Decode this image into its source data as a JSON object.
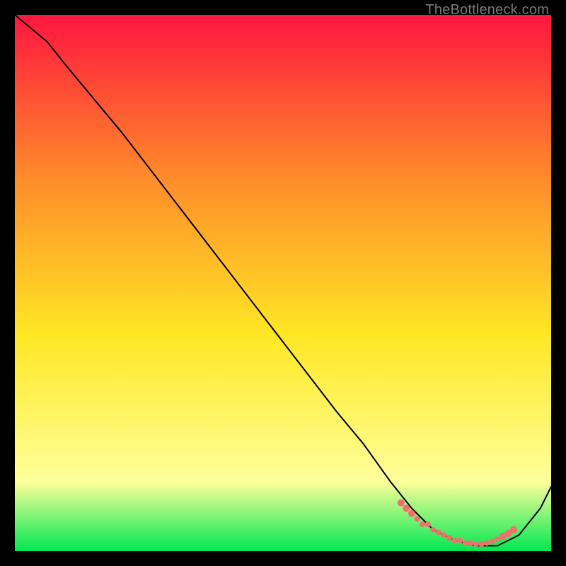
{
  "watermark": "TheBottleneck.com",
  "colors": {
    "frame": "#000000",
    "gradient_top": "#ff163f",
    "gradient_mid_upper": "#ff8a2a",
    "gradient_mid": "#ffe824",
    "gradient_low": "#ffff9a",
    "gradient_bottom": "#00e851",
    "line": "#000000",
    "marker": "#f2706b"
  },
  "chart_data": {
    "type": "line",
    "title": "",
    "xlabel": "",
    "ylabel": "",
    "xlim": [
      0,
      100
    ],
    "ylim": [
      0,
      100
    ],
    "grid": false,
    "legend": false,
    "series": [
      {
        "name": "curve",
        "x": [
          0,
          6,
          10,
          20,
          30,
          40,
          50,
          60,
          65,
          70,
          74,
          78,
          82,
          86,
          90,
          94,
          98,
          100
        ],
        "y": [
          100,
          95,
          90,
          78,
          65,
          52,
          39,
          26,
          20,
          13,
          8,
          4,
          2,
          1,
          1,
          3,
          8,
          12
        ]
      }
    ],
    "markers": {
      "name": "highlight-region",
      "x": [
        72,
        73,
        74,
        75,
        76,
        77,
        78,
        79,
        80,
        81,
        82,
        83,
        84,
        85,
        86,
        87,
        88,
        89,
        90,
        91,
        92,
        93
      ],
      "y": [
        9,
        8,
        7,
        6,
        5,
        5,
        4,
        3.5,
        3,
        2.5,
        2,
        2,
        1.5,
        1.5,
        1.3,
        1.3,
        1.5,
        1.8,
        2.2,
        2.8,
        3.3,
        4
      ]
    }
  }
}
